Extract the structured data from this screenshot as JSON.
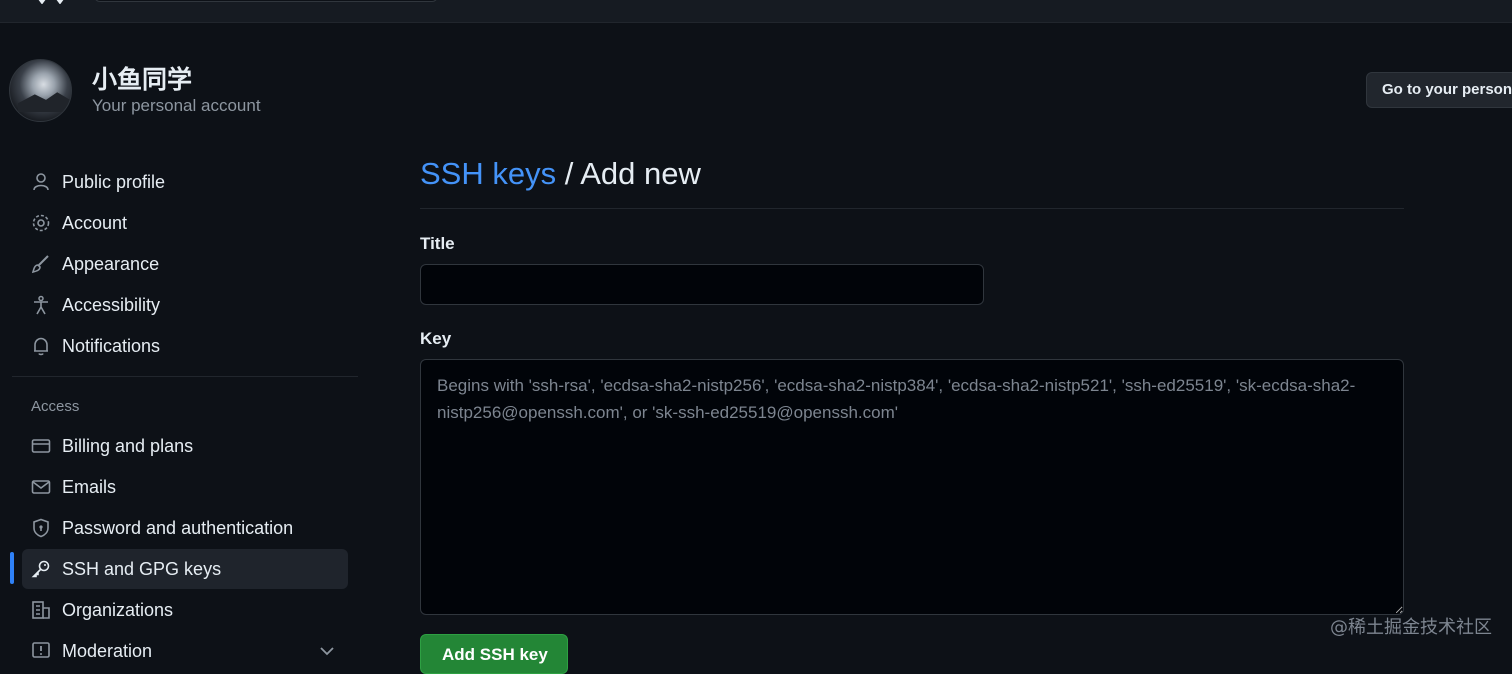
{
  "account": {
    "name": "小鱼同学",
    "subtitle": "Your personal account",
    "goto_button": "Go to your personal profile"
  },
  "sidebar": {
    "items": [
      {
        "label": "Public profile",
        "icon": "person-icon"
      },
      {
        "label": "Account",
        "icon": "gear-icon"
      },
      {
        "label": "Appearance",
        "icon": "paintbrush-icon"
      },
      {
        "label": "Accessibility",
        "icon": "accessibility-icon"
      },
      {
        "label": "Notifications",
        "icon": "bell-icon"
      }
    ],
    "access_section_label": "Access",
    "access_items": [
      {
        "label": "Billing and plans",
        "icon": "credit-card-icon"
      },
      {
        "label": "Emails",
        "icon": "mail-icon"
      },
      {
        "label": "Password and authentication",
        "icon": "shield-lock-icon"
      },
      {
        "label": "SSH and GPG keys",
        "icon": "key-icon",
        "active": true
      },
      {
        "label": "Organizations",
        "icon": "organization-icon"
      },
      {
        "label": "Moderation",
        "icon": "report-icon"
      }
    ]
  },
  "main": {
    "breadcrumb_link": "SSH keys",
    "breadcrumb_separator": " / ",
    "breadcrumb_current": "Add new",
    "title_label": "Title",
    "title_value": "",
    "key_label": "Key",
    "key_placeholder": "Begins with 'ssh-rsa', 'ecdsa-sha2-nistp256', 'ecdsa-sha2-nistp384', 'ecdsa-sha2-nistp521', 'ssh-ed25519', 'sk-ecdsa-sha2-nistp256@openssh.com', or 'sk-ssh-ed25519@openssh.com'",
    "submit_label": "Add SSH key"
  },
  "watermark": "@稀土掘金技术社区",
  "colors": {
    "background": "#0d1117",
    "link": "#4493f8",
    "primary_button": "#238636",
    "active_indicator": "#2f81f7"
  }
}
